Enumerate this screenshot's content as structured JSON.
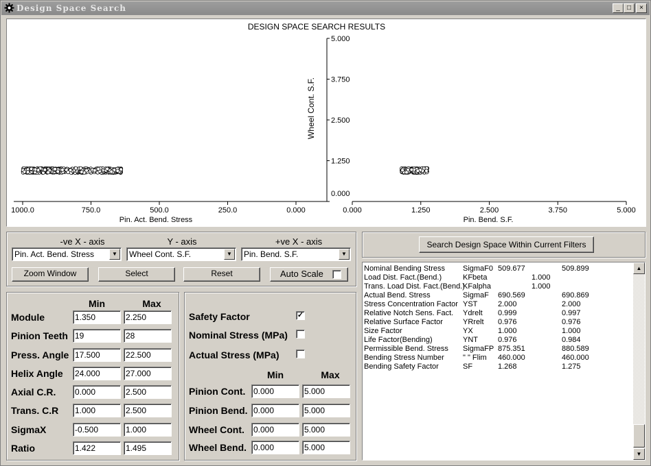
{
  "window": {
    "title": "Design Space Search",
    "min_glyph": "_",
    "max_glyph": "□",
    "close_glyph": "×"
  },
  "plot": {
    "title": "DESIGN SPACE SEARCH RESULTS",
    "y_label": "Wheel Cont. S.F.",
    "y_ticks": [
      "5.000",
      "3.750",
      "2.500",
      "1.250",
      "0.000"
    ],
    "left_x_label": "Pin. Act. Bend. Stress",
    "left_x_ticks": [
      "1000.0",
      "750.0",
      "500.0",
      "250.0",
      "0.000"
    ],
    "right_x_label": "Pin. Bend. S.F.",
    "right_x_ticks": [
      "0.000",
      "1.250",
      "2.500",
      "3.750",
      "5.000"
    ]
  },
  "chart_data": {
    "type": "scatter",
    "title": "DESIGN SPACE SEARCH RESULTS",
    "ylabel": "Wheel Cont. S.F.",
    "ylim": [
      0,
      5
    ],
    "left_panel": {
      "xlabel": "Pin. Act. Bend. Stress",
      "xlim": [
        1000,
        0
      ],
      "cluster_x_range": [
        640,
        1000
      ],
      "cluster_y_range": [
        0.88,
        1.02
      ]
    },
    "right_panel": {
      "xlabel": "Pin. Bend. S.F.",
      "xlim": [
        0,
        5
      ],
      "cluster_x_range": [
        0.9,
        1.37
      ],
      "cluster_y_range": [
        0.88,
        1.02
      ]
    },
    "grid": false
  },
  "axes": {
    "neg_x_title": "-ve X - axis",
    "y_title": "Y - axis",
    "pos_x_title": "+ve X - axis",
    "neg_x_value": "Pin. Act. Bend. Stress",
    "y_value": "Wheel Cont. S.F.",
    "pos_x_value": "Pin. Bend. S.F.",
    "arrow_glyph": "▼",
    "zoom_label": "Zoom Window",
    "select_label": "Select",
    "reset_label": "Reset",
    "autoscale_label": "Auto Scale",
    "autoscale_checked": ""
  },
  "search_button": "Search Design Space Within Current Filters",
  "params": {
    "min_header": "Min",
    "max_header": "Max",
    "rows": [
      {
        "label": "Module",
        "min": "1.350",
        "max": "2.250"
      },
      {
        "label": "Pinion Teeth",
        "min": "19",
        "max": "28"
      },
      {
        "label": "Press. Angle",
        "min": "17.500",
        "max": "22.500"
      },
      {
        "label": "Helix Angle",
        "min": "24.000",
        "max": "27.000"
      },
      {
        "label": "Axial C.R.",
        "min": "0.000",
        "max": "2.500"
      },
      {
        "label": "Trans. C.R",
        "min": "1.000",
        "max": "2.500"
      },
      {
        "label": "SigmaX",
        "min": "-0.500",
        "max": "1.000"
      },
      {
        "label": "Ratio",
        "min": "1.422",
        "max": "1.495"
      }
    ]
  },
  "filters": {
    "safety_factor": "Safety Factor",
    "safety_checked": "✓",
    "nominal_stress": "Nominal Stress (MPa)",
    "nominal_checked": "",
    "actual_stress": "Actual Stress (MPa)",
    "actual_checked": "",
    "min_header": "Min",
    "max_header": "Max",
    "rows": [
      {
        "label": "Pinion Cont.",
        "min": "0.000",
        "max": "5.000"
      },
      {
        "label": "Pinion Bend.",
        "min": "0.000",
        "max": "5.000"
      },
      {
        "label": "Wheel Cont.",
        "min": "0.000",
        "max": "5.000"
      },
      {
        "label": "Wheel Bend.",
        "min": "0.000",
        "max": "5.000"
      }
    ]
  },
  "results": {
    "rows": [
      [
        "Nominal Bending Stress",
        "SigmaF0",
        "509.677",
        "",
        "509.899"
      ],
      [
        "Load Dist. Fact.(Bend.)",
        "KFbeta",
        "",
        "1.000",
        ""
      ],
      [
        "Trans. Load Dist. Fact.(Bend.)",
        "KFalpha",
        "",
        "1.000",
        ""
      ],
      [
        "Actual Bend. Stress",
        "SigmaF",
        "690.569",
        "",
        "690.869"
      ],
      [
        "Stress Concentration Factor",
        "YST",
        "2.000",
        "",
        "2.000"
      ],
      [
        "Relative Notch Sens. Fact.",
        "Ydrelt",
        "0.999",
        "",
        "0.997"
      ],
      [
        "Relative Surface Factor",
        "YRrelt",
        "0.976",
        "",
        "0.976"
      ],
      [
        "Size Factor",
        "YX",
        "1.000",
        "",
        "1.000"
      ],
      [
        "Life Factor(Bending)",
        "YNT",
        "0.976",
        "",
        "0.984"
      ],
      [
        "Permissible Bend. Stress",
        "SigmaFP",
        "875.351",
        "",
        "880.589"
      ],
      [
        "Bending Stress Number",
        "\"   \" Flim",
        "460.000",
        "",
        "460.000"
      ],
      [
        "Bending Safety Factor",
        "SF",
        "1.268",
        "",
        "1.275"
      ]
    ],
    "scroll_up": "▲",
    "scroll_down": "▼"
  }
}
